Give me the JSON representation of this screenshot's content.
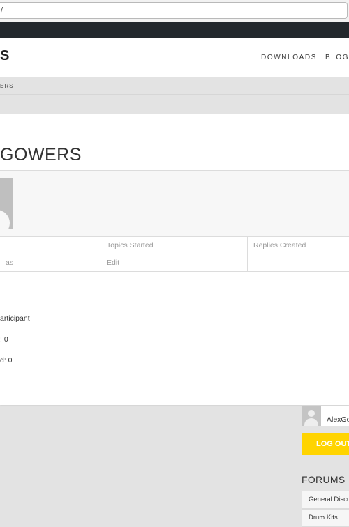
{
  "browser": {
    "address_text": "/"
  },
  "header": {
    "brand_fragment": "S",
    "nav": [
      {
        "label": "DOWNLOADS"
      },
      {
        "label": "BLOG"
      }
    ]
  },
  "breadcrumb": {
    "text": "ERS"
  },
  "profile": {
    "title": "GOWERS",
    "tabs": [
      {
        "label": ""
      },
      {
        "label": "Topics Started"
      },
      {
        "label": "Replies Created"
      },
      {
        "label": "as"
      },
      {
        "label": "Edit"
      },
      {
        "label": ""
      }
    ],
    "info": {
      "role": "articipant",
      "topics": ": 0",
      "replies": "d: 0"
    }
  },
  "sidebar": {
    "user_name": "AlexGo",
    "logout_label": "LOG OUT",
    "forums_title": "FORUMS",
    "forums": [
      {
        "label": "General Discu"
      },
      {
        "label": "Drum Kits"
      }
    ]
  },
  "colors": {
    "accent": "#ffd400",
    "topbar": "#23282d",
    "band": "#e3e3e3"
  }
}
